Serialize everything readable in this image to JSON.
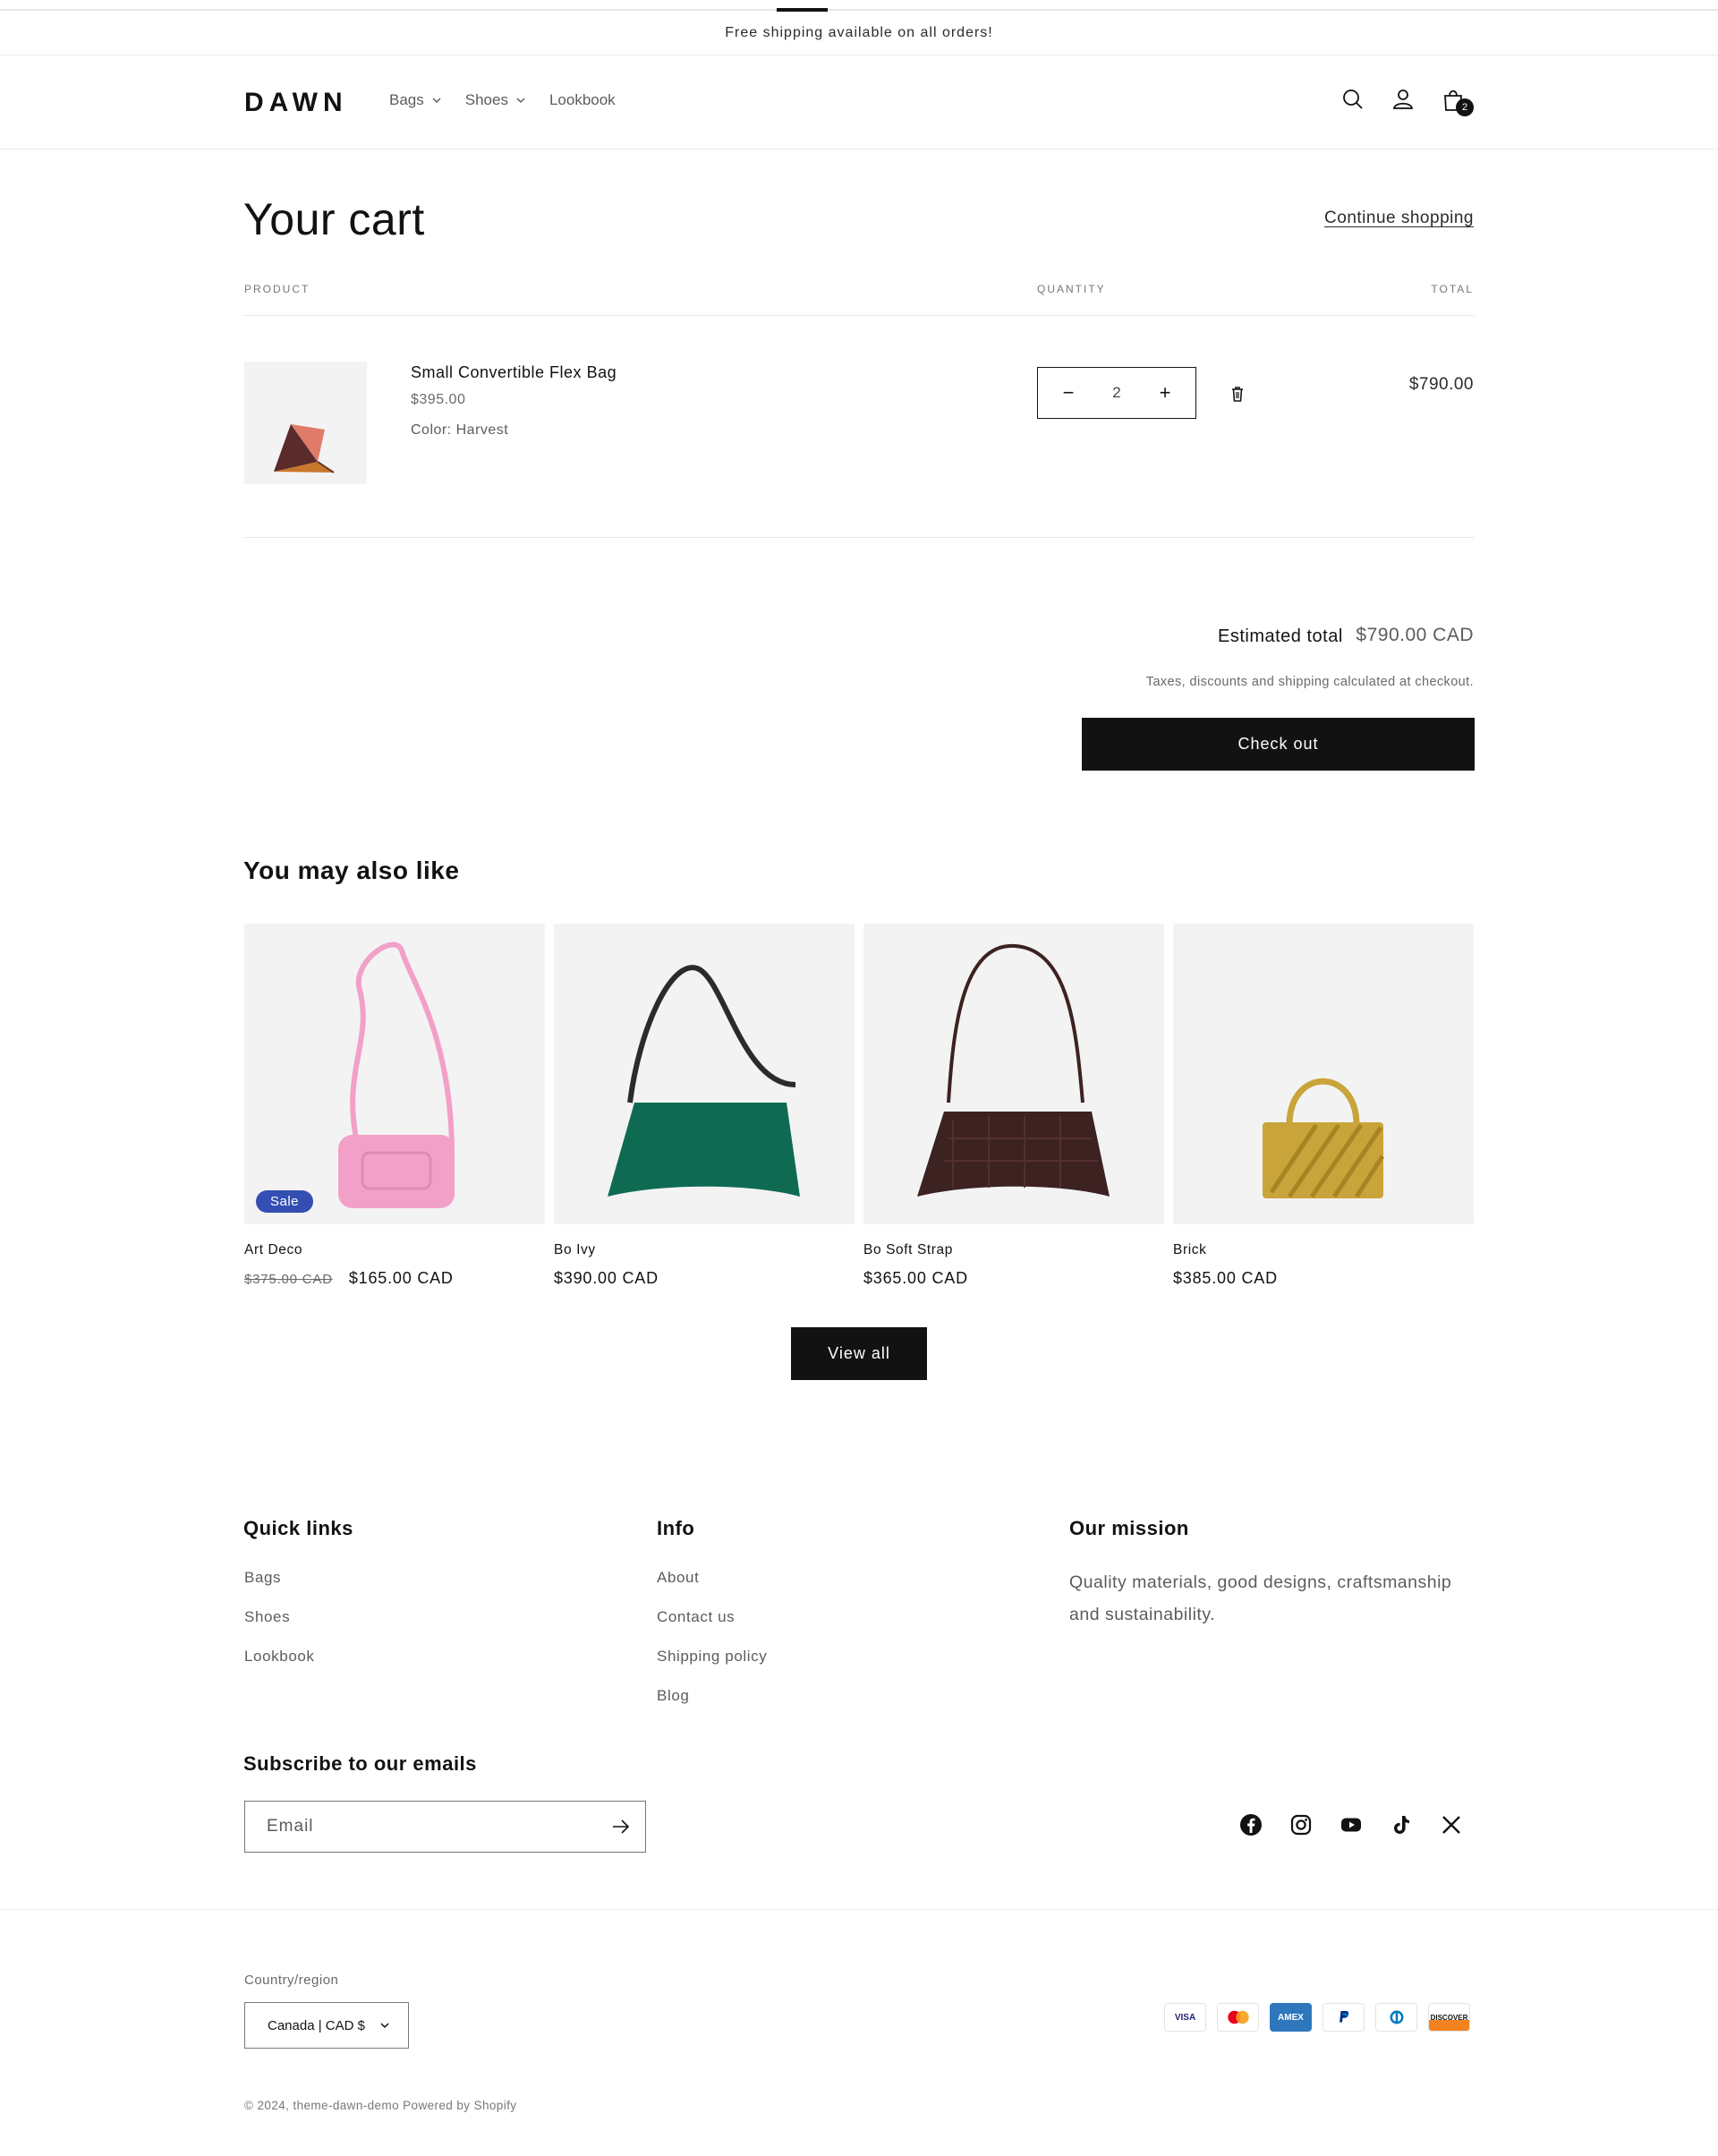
{
  "announcement": "Free shipping available on all orders!",
  "header": {
    "logo": "DAWN",
    "nav": [
      {
        "label": "Bags",
        "dropdown": true
      },
      {
        "label": "Shoes",
        "dropdown": true
      },
      {
        "label": "Lookbook",
        "dropdown": false
      }
    ],
    "icons": [
      "search-icon",
      "account-icon",
      "cart-icon"
    ],
    "cart_count": "2"
  },
  "cart": {
    "title": "Your cart",
    "continue_label": "Continue shopping",
    "columns": {
      "product": "PRODUCT",
      "quantity": "QUANTITY",
      "total": "TOTAL"
    },
    "items": [
      {
        "name": "Small Convertible Flex Bag",
        "price": "$395.00",
        "option": "Color: Harvest",
        "quantity": "2",
        "line_total": "$790.00"
      }
    ],
    "estimated_label": "Estimated total",
    "estimated_value": "$790.00 CAD",
    "tax_note": "Taxes, discounts and shipping calculated at checkout.",
    "checkout_label": "Check out"
  },
  "recommendations": {
    "title": "You may also like",
    "products": [
      {
        "name": "Art Deco",
        "compare_price": "$375.00 CAD",
        "price": "$165.00 CAD",
        "badge": "Sale",
        "color": "#f2a0c8"
      },
      {
        "name": "Bo Ivy",
        "compare_price": "",
        "price": "$390.00 CAD",
        "badge": "",
        "color": "#0e6b52"
      },
      {
        "name": "Bo Soft Strap",
        "compare_price": "",
        "price": "$365.00 CAD",
        "badge": "",
        "color": "#3d2222"
      },
      {
        "name": "Brick",
        "compare_price": "",
        "price": "$385.00 CAD",
        "badge": "",
        "color": "#c8a43a"
      }
    ],
    "view_all_label": "View all"
  },
  "footer": {
    "quick_links": {
      "heading": "Quick links",
      "links": [
        "Bags",
        "Shoes",
        "Lookbook"
      ]
    },
    "info": {
      "heading": "Info",
      "links": [
        "About",
        "Contact us",
        "Shipping policy",
        "Blog"
      ]
    },
    "mission": {
      "heading": "Our mission",
      "text": "Quality materials, good designs, craftsmanship and sustainability."
    },
    "subscribe": {
      "heading": "Subscribe to our emails",
      "placeholder": "Email"
    },
    "socials": [
      "facebook-icon",
      "instagram-icon",
      "youtube-icon",
      "tiktok-icon",
      "x-icon"
    ],
    "country_label": "Country/region",
    "country_value": "Canada | CAD $",
    "payments": [
      "VISA",
      "Mastercard",
      "AMEX",
      "PayPal",
      "Diners",
      "DISCOVER"
    ],
    "copyright": "© 2024, theme-dawn-demo Powered by Shopify"
  },
  "colors": {
    "primary": "#121212",
    "sale_badge": "#334fb4",
    "muted_text": "#5c5c5c",
    "image_bg": "#f3f3f3"
  }
}
